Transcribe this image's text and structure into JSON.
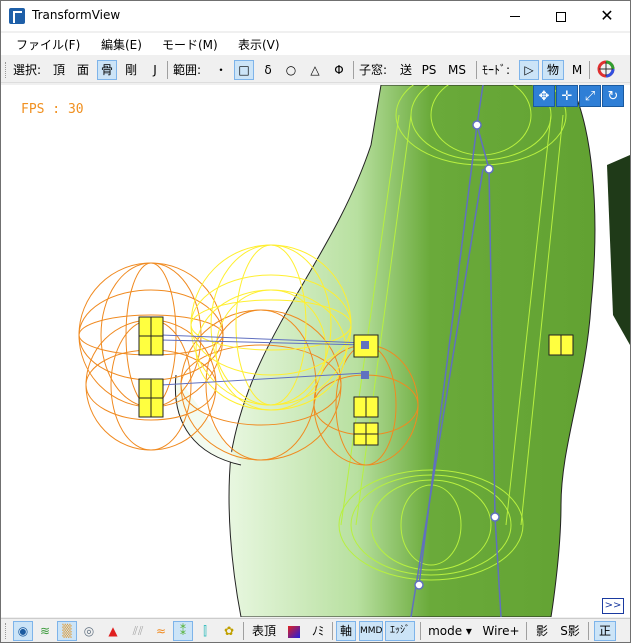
{
  "window": {
    "title": "TransformView"
  },
  "menu": [
    {
      "label": "ファイル(F)"
    },
    {
      "label": "編集(E)"
    },
    {
      "label": "モード(M)"
    },
    {
      "label": "表示(V)"
    }
  ],
  "toolbar": {
    "select_label": "選択:",
    "select_vertex": "頂",
    "select_face": "面",
    "select_bone": "骨",
    "select_rigid": "剛",
    "select_joint": "J",
    "range_label": "範囲:",
    "range_point": "・",
    "range_rect": "□",
    "range_delta": "δ",
    "range_circle": "○",
    "range_triangle": "△",
    "range_phi": "Φ",
    "subwindow_label": "子窓:",
    "sub_send": "送",
    "sub_ps": "PS",
    "sub_ms": "MS",
    "mode_label": "ﾓｰﾄﾞ:",
    "mode_play": "▷",
    "mode_physics": "物",
    "mode_m": "M"
  },
  "viewport": {
    "fps_text": "FPS : 30",
    "expand_label": ">>"
  },
  "bottombar": {
    "vertex_display": "表頂",
    "nomi": "ﾉﾐ",
    "axis": "軸",
    "mmd": "MMD",
    "edge": "ｴｯｼﾞ",
    "mode": "mode ▾",
    "wire_plus": "Wire+",
    "shadow": "影",
    "s_shadow": "S影",
    "front": "正"
  },
  "colors": {
    "accent": "#2f7fd6",
    "fps": "#f09020",
    "selected": "#cce4f7",
    "model_green": "#6aaa3a",
    "orange_sphere": "#f08a20",
    "yellow_sphere": "#ffef30",
    "bone": "#6070c0"
  }
}
